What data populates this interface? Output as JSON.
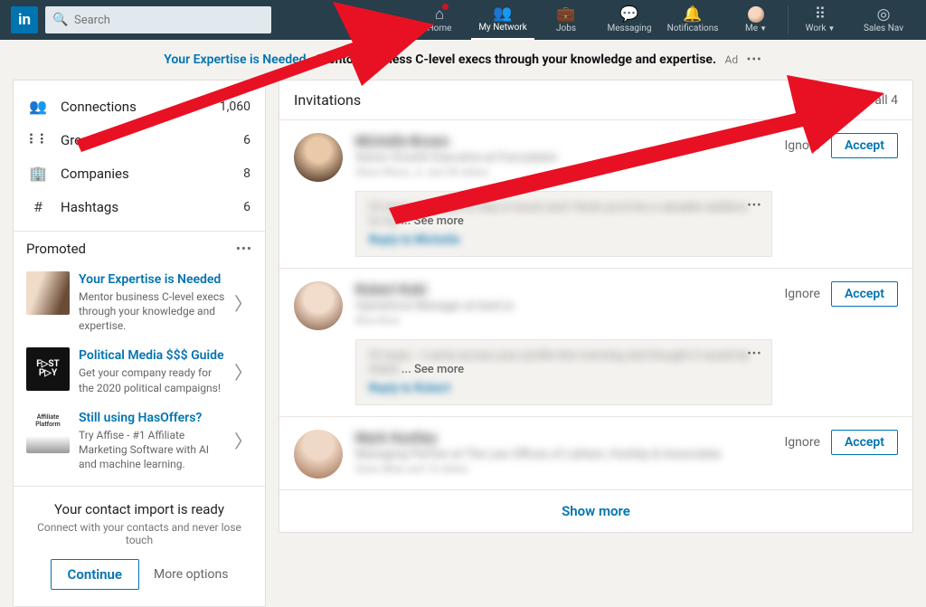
{
  "header": {
    "logo": "in",
    "search_placeholder": "Search",
    "nav": {
      "home": "Home",
      "network": "My Network",
      "jobs": "Jobs",
      "messaging": "Messaging",
      "notifications": "Notifications",
      "me": "Me",
      "work": "Work",
      "salesnav": "Sales Nav"
    }
  },
  "ad": {
    "lead": "Your Expertise is Needed - ",
    "body": "Mentor business C-level execs through your knowledge and expertise.",
    "tag": "Ad"
  },
  "sidebar": {
    "items": [
      {
        "label": "Connections",
        "count": "1,060"
      },
      {
        "label": "Groups",
        "count": "6"
      },
      {
        "label": "Companies",
        "count": "8"
      },
      {
        "label": "Hashtags",
        "count": "6"
      }
    ],
    "promoted": {
      "title": "Promoted",
      "ads": [
        {
          "title": "Your Expertise is Needed",
          "desc": "Mentor business C-level execs through your knowledge and expertise."
        },
        {
          "title": "Political Media $$$ Guide",
          "desc": "Get your company ready for the 2020 political campaigns!"
        },
        {
          "title": "Still using HasOffers?",
          "desc": "Try Affise - #1 Affiliate Marketing Software with AI and machine learning."
        }
      ]
    },
    "import": {
      "title": "Your contact import is ready",
      "sub": "Connect with your contacts and never lose touch",
      "continue": "Continue",
      "more": "More options"
    }
  },
  "invitations": {
    "title": "Invitations",
    "see_all": "See all 4",
    "ignore": "Ignore",
    "accept": "Accept",
    "show_more": "Show more",
    "items": [
      {
        "name": "Michelle Brown",
        "title": "Senior Growth Executive at Funcubator",
        "meta": "Steve Wison, Jr. and 30 others",
        "msg": "Hi Isaac, I wanted to stay in touch and I think you'd be a valuable addition to my",
        "seemore": "... See more",
        "reply": "Reply to Michelle"
      },
      {
        "name": "Robert Koki",
        "title": "Operations Manager at bant.io",
        "meta": "Nina Nuro",
        "msg": "Hi Isaac - I came across your profile this morning and thought it would be intere",
        "seemore": "... See more",
        "reply": "Reply to Robert"
      },
      {
        "name": "Mark Huntley",
        "title": "Managing Partner at The Law Offices of Latham, Huntley & Associates",
        "meta": "Diann Bilan and 14 others"
      }
    ]
  }
}
